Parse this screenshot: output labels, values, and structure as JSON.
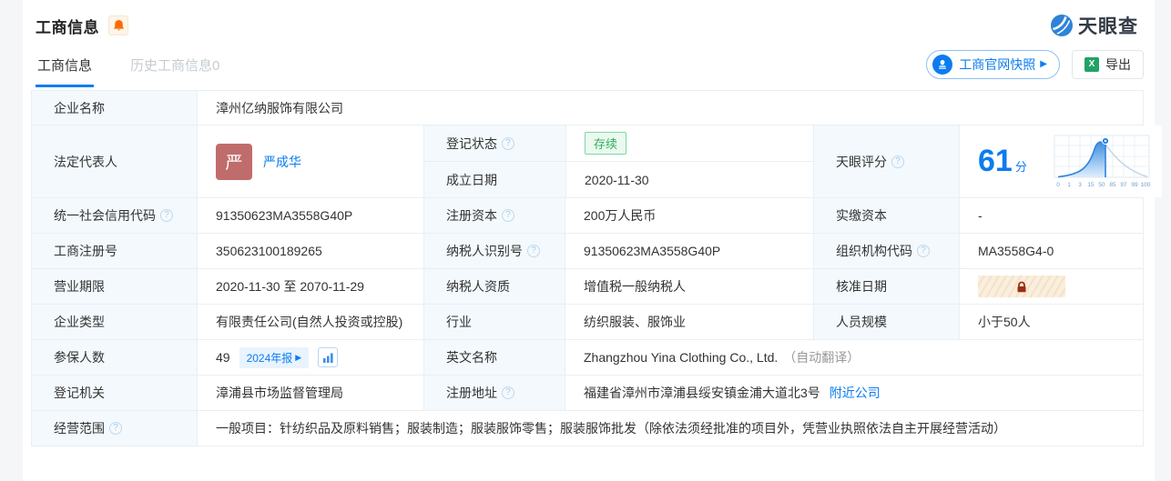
{
  "header": {
    "title": "工商信息",
    "logo_text": "天眼查",
    "tabs": [
      {
        "label": "工商信息"
      },
      {
        "label": "历史工商信息0"
      }
    ],
    "snapshot_button": "工商官网快照",
    "export_button": "导出"
  },
  "colors": {
    "accent": "#0b7cf0",
    "status_green": "#2fae58",
    "bell_orange": "#ff6a00",
    "label_bg": "#f3f9fd"
  },
  "fields": {
    "company_name": {
      "label": "企业名称",
      "value": "漳州亿纳服饰有限公司"
    },
    "legal_rep": {
      "label": "法定代表人",
      "avatar_char": "严",
      "name": "严成华"
    },
    "reg_status": {
      "label": "登记状态",
      "value": "存续"
    },
    "establish_date": {
      "label": "成立日期",
      "value": "2020-11-30"
    },
    "score": {
      "label": "天眼评分",
      "value": "61",
      "unit": "分",
      "axis": [
        "0",
        "1",
        "3",
        "15",
        "50",
        "85",
        "97",
        "99",
        "100"
      ]
    },
    "credit_code": {
      "label": "统一社会信用代码",
      "value": "91350623MA3558G40P"
    },
    "reg_capital": {
      "label": "注册资本",
      "value": "200万人民币"
    },
    "paid_capital": {
      "label": "实缴资本",
      "value": "-"
    },
    "reg_number": {
      "label": "工商注册号",
      "value": "350623100189265"
    },
    "taxpayer_id": {
      "label": "纳税人识别号",
      "value": "91350623MA3558G40P"
    },
    "org_code": {
      "label": "组织机构代码",
      "value": "MA3558G4-0"
    },
    "business_term": {
      "label": "营业期限",
      "value": "2020-11-30 至 2070-11-29"
    },
    "taxpayer_quality": {
      "label": "纳税人资质",
      "value": "增值税一般纳税人"
    },
    "approval_date": {
      "label": "核准日期"
    },
    "company_type": {
      "label": "企业类型",
      "value": "有限责任公司(自然人投资或控股)"
    },
    "industry": {
      "label": "行业",
      "value": "纺织服装、服饰业"
    },
    "staff_size": {
      "label": "人员规模",
      "value": "小于50人"
    },
    "insured_count": {
      "label": "参保人数",
      "value": "49",
      "tag": "2024年报"
    },
    "english_name": {
      "label": "英文名称",
      "value": "Zhangzhou Yina Clothing Co., Ltd.",
      "note": "（自动翻译）"
    },
    "reg_authority": {
      "label": "登记机关",
      "value": "漳浦县市场监督管理局"
    },
    "reg_address": {
      "label": "注册地址",
      "value": "福建省漳州市漳浦县绥安镇金浦大道北3号",
      "link": "附近公司"
    },
    "business_scope": {
      "label": "经营范围",
      "value": "一般项目：针纺织品及原料销售；服装制造；服装服饰零售；服装服饰批发（除依法须经批准的项目外，凭营业执照依法自主开展经营活动）"
    }
  },
  "chart_data": {
    "type": "area",
    "title": "天眼评分分布曲线",
    "x_tick_labels": [
      "0",
      "1",
      "3",
      "15",
      "50",
      "85",
      "97",
      "99",
      "100"
    ],
    "marker_score": 61,
    "score_display": "61分",
    "shape": "bell-curve, filled blue left of marker, gray right of marker",
    "grid": true
  }
}
